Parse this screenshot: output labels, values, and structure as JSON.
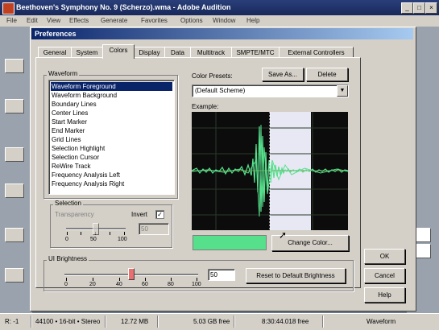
{
  "app": {
    "title": "Beethoven's Symphony No. 9 (Scherzo).wma - Adobe Audition",
    "menu": [
      "File",
      "Edit",
      "View",
      "Effects",
      "Generate",
      "Favorites",
      "Options",
      "Window",
      "Help"
    ],
    "status": [
      "R: -1",
      "44100 • 16-bit • Stereo",
      "12.72 MB",
      "5.03 GB free",
      "8:30:44.018 free",
      "Waveform"
    ]
  },
  "dialog": {
    "title": "Preferences",
    "tabs": [
      "General",
      "System",
      "Colors",
      "Display",
      "Data",
      "Multitrack",
      "SMPTE/MTC",
      "External Controllers"
    ],
    "active_tab": "Colors",
    "waveform_group_label": "Waveform",
    "waveform_items": [
      "Waveform Foreground",
      "Waveform Background",
      "Boundary Lines",
      "Center Lines",
      "Start Marker",
      "End Marker",
      "Grid Lines",
      "Selection Highlight",
      "Selection Cursor",
      "ReWire Track",
      "Frequency Analysis Left",
      "Frequency Analysis Right"
    ],
    "selected_item": "Waveform Foreground",
    "selection_group_label": "Selection",
    "transparency_label": "Transparency",
    "transparency_scale": [
      "0",
      "50",
      "100"
    ],
    "transparency_value": "50",
    "invert_label": "Invert",
    "invert_checked": true,
    "ui_brightness_label": "UI Brightness",
    "brightness_scale": [
      "0",
      "20",
      "40",
      "60",
      "80",
      "100"
    ],
    "brightness_value": "50",
    "reset_brightness_label": "Reset to Default Brightness",
    "color_presets_label": "Color Presets:",
    "save_as_label": "Save As...",
    "delete_label": "Delete",
    "preset_value": "(Default Scheme)",
    "example_label": "Example:",
    "swatch_color": "#56e08c",
    "change_color_label": "Change Color...",
    "ok_label": "OK",
    "cancel_label": "Cancel",
    "help_label": "Help"
  }
}
